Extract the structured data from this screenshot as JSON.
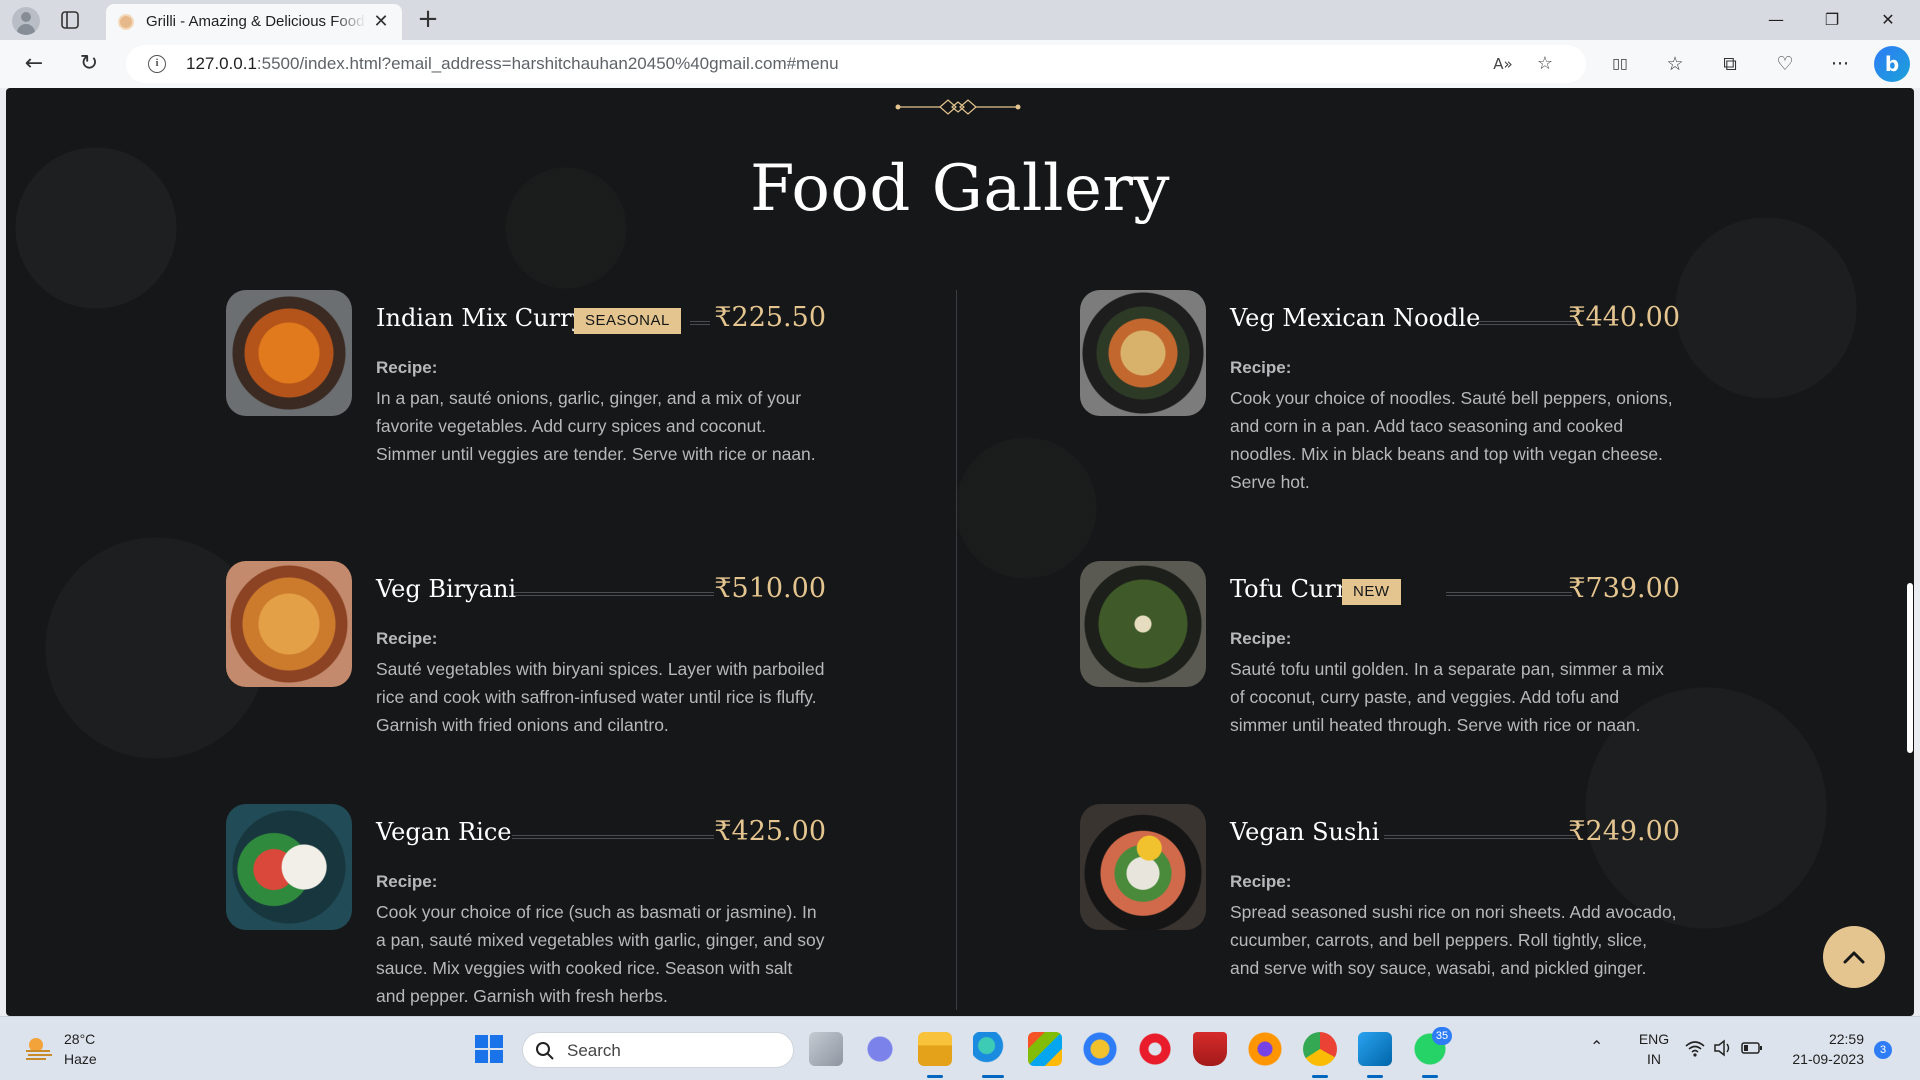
{
  "browser": {
    "tab_title": "Grilli - Amazing & Delicious Food",
    "tab_close": "✕",
    "new_tab": "+",
    "url_host": "127.0.0.1",
    "url_rest": ":5500/index.html?email_address=harshitchauhan20450%40gmail.com#menu",
    "window_controls": {
      "minimize": "—",
      "restore": "❐",
      "close": "✕"
    },
    "nav": {
      "back": "←",
      "reload": "↻"
    },
    "address_icons": {
      "read_aloud": "A»",
      "favorite": "☆"
    },
    "toolbar": {
      "split": "▯▯",
      "favorites": "☆",
      "collections": "⧉",
      "health": "♡",
      "more": "···",
      "copilot": "b"
    }
  },
  "page": {
    "title": "Food Gallery",
    "recipe_label": "Recipe:",
    "items": [
      {
        "name": "Indian Mix Curry",
        "badge": "SEASONAL",
        "price": "₹225.50",
        "recipe": "In a pan, sauté onions, garlic, ginger, and a mix of your favorite vegetables. Add curry spices and coconut. Simmer until veggies are tender. Serve with rice or naan."
      },
      {
        "name": "Veg Mexican Noodle",
        "badge": "",
        "price": "₹440.00",
        "recipe": "Cook your choice of noodles. Sauté bell peppers, onions, and corn in a pan. Add taco seasoning and cooked noodles. Mix in black beans and top with vegan cheese. Serve hot."
      },
      {
        "name": "Veg Biryani",
        "badge": "",
        "price": "₹510.00",
        "recipe": "Sauté vegetables with biryani spices. Layer with parboiled rice and cook with saffron-infused water until rice is fluffy. Garnish with fried onions and cilantro."
      },
      {
        "name": "Tofu Curry",
        "badge": "NEW",
        "price": "₹739.00",
        "recipe": "Sauté tofu until golden. In a separate pan, simmer a mix of coconut, curry paste, and veggies. Add tofu and simmer until heated through. Serve with rice or naan."
      },
      {
        "name": "Vegan Rice",
        "badge": "",
        "price": "₹425.00",
        "recipe": "Cook your choice of rice (such as basmati or jasmine). In a pan, sauté mixed vegetables with garlic, ginger, and soy sauce. Mix veggies with cooked rice. Season with salt and pepper. Garnish with fresh herbs."
      },
      {
        "name": "Vegan Sushi",
        "badge": "",
        "price": "₹249.00",
        "recipe": "Spread seasoned sushi rice on nori sheets. Add avocado, cucumber, carrots, and bell peppers. Roll tightly, slice, and serve with soy sauce, wasabi, and pickled ginger."
      }
    ],
    "accent_color": "#e4c590",
    "background_color": "#161718"
  },
  "taskbar": {
    "weather_temp": "28°C",
    "weather_desc": "Haze",
    "search_placeholder": "Search",
    "whatsapp_badge": "35",
    "language": "ENG",
    "region": "IN",
    "time": "22:59",
    "date": "21-09-2023",
    "notification_count": "3"
  }
}
